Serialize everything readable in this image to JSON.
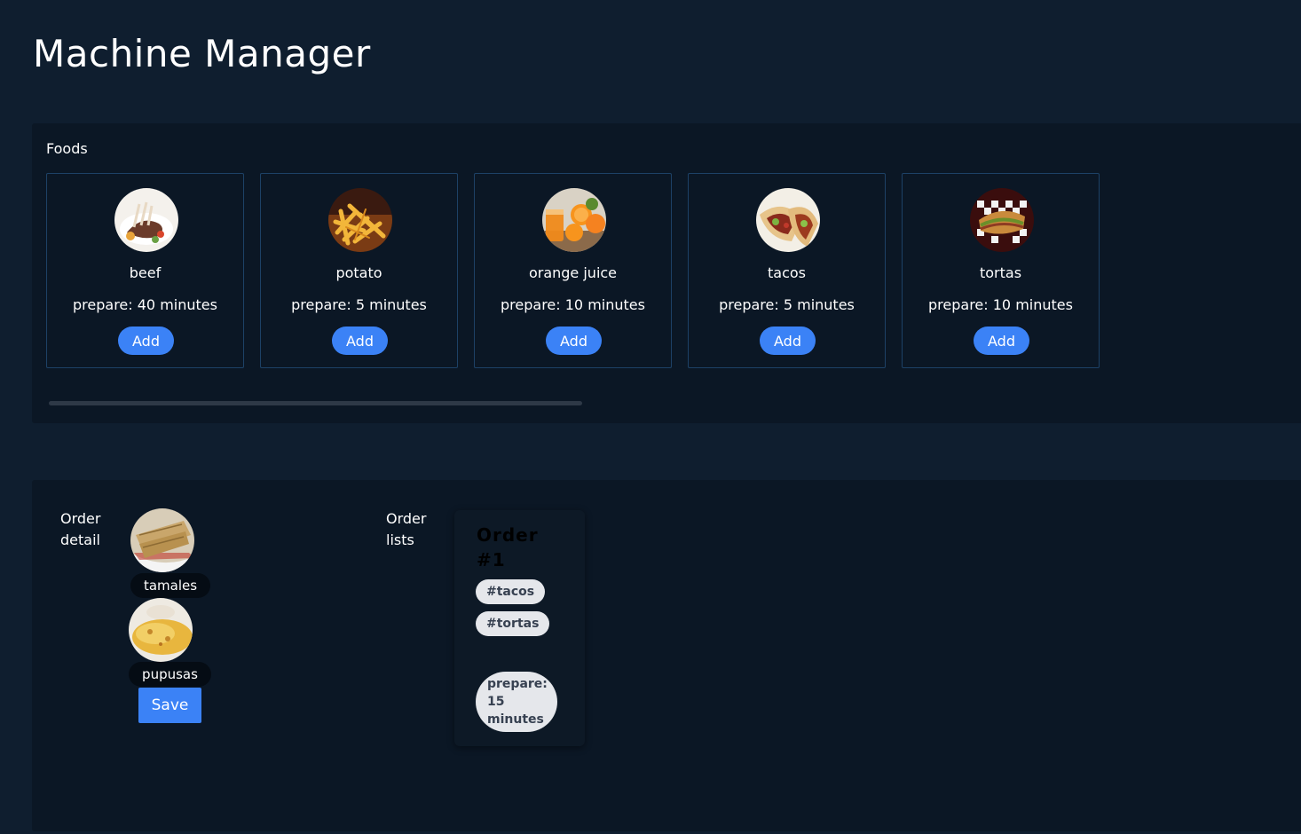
{
  "page": {
    "title": "Machine Manager"
  },
  "foods": {
    "label": "Foods",
    "items": [
      {
        "name": "beef",
        "prepare": "prepare: 40 minutes",
        "add_label": "Add",
        "image": "beef-plate-icon"
      },
      {
        "name": "potato",
        "prepare": "prepare: 5 minutes",
        "add_label": "Add",
        "image": "fries-icon"
      },
      {
        "name": "orange juice",
        "prepare": "prepare: 10 minutes",
        "add_label": "Add",
        "image": "orange-juice-icon"
      },
      {
        "name": "tacos",
        "prepare": "prepare: 5 minutes",
        "add_label": "Add",
        "image": "tacos-icon"
      },
      {
        "name": "tortas",
        "prepare": "prepare: 10 minutes",
        "add_label": "Add",
        "image": "torta-sandwich-icon"
      }
    ]
  },
  "order_detail": {
    "label": "Order detail",
    "items": [
      {
        "name": "tamales",
        "image": "tamales-icon"
      },
      {
        "name": "pupusas",
        "image": "pupusas-icon"
      }
    ],
    "save_label": "Save"
  },
  "order_lists": {
    "label": "Order lists",
    "orders": [
      {
        "title": "Order #1",
        "tags": [
          "#tacos",
          "#tortas"
        ],
        "prepare": "prepare: 15 minutes"
      }
    ]
  },
  "colors": {
    "background": "#0f1e2f",
    "panel": "#0b1725",
    "card_border": "#1d4166",
    "accent": "#3b82f6",
    "tag_background": "#e5e7eb",
    "tag_text": "#374151"
  }
}
